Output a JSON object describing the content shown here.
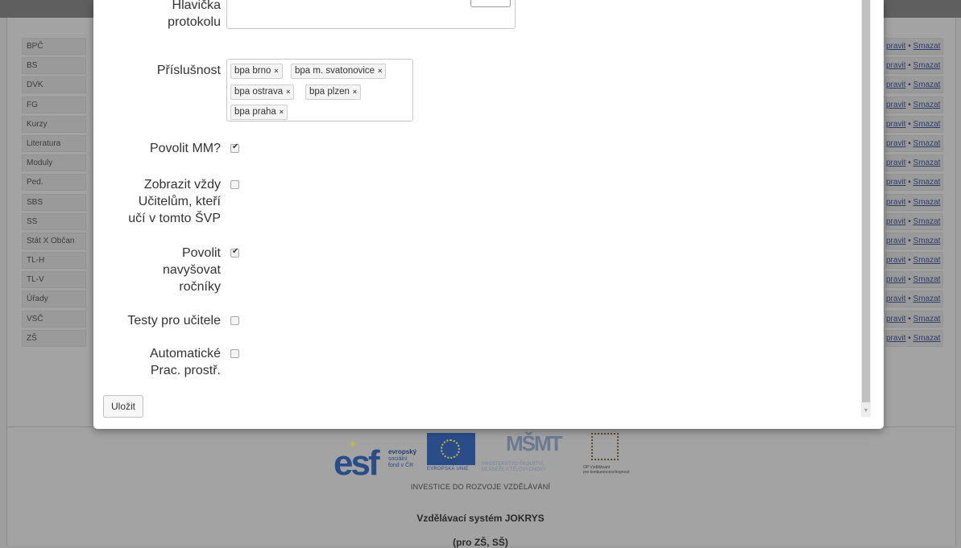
{
  "background": {
    "rows": [
      {
        "name": "BPČ"
      },
      {
        "name": "BS"
      },
      {
        "name": "DVK"
      },
      {
        "name": "FG"
      },
      {
        "name": "Kurzy"
      },
      {
        "name": "Literatura"
      },
      {
        "name": "Moduly"
      },
      {
        "name": "Ped."
      },
      {
        "name": "SBS"
      },
      {
        "name": "SS"
      },
      {
        "name": "Stát X Občan"
      },
      {
        "name": "TL-H"
      },
      {
        "name": "TL-V"
      },
      {
        "name": "Úřady"
      },
      {
        "name": "VSČ"
      },
      {
        "name": "ZŠ"
      }
    ],
    "edit_link": "pravit",
    "delete_link": "Smazat",
    "separator": "•",
    "footer": {
      "esf_letters": "esf",
      "esf_text_1": "evropský",
      "esf_text_2": "sociální",
      "esf_text_3": "fond v ČR",
      "eu_label": "EVROPSKÁ UNIE",
      "msmt_mark": "MŠMT",
      "msmt_text_1": "MINISTERSTVO ŠKOLSTVÍ,",
      "msmt_text_2": "MLÁDEŽE A TĚLOVÝCHOVY",
      "op_text_1": "OP Vzdělávání",
      "op_text_2": "pro konkurenceschopnost",
      "investice": "INVESTICE DO ROZVOJE VZDĚLÁVÁNÍ",
      "system_name": "Vzdělávací systém JOKRYS",
      "system_sub": "(pro ZŠ, SŠ)"
    }
  },
  "modal": {
    "header_label_1": "Hlavička",
    "header_label_2": "protokolu",
    "header_value": "",
    "membership_label": "Příslušnost",
    "tags": [
      {
        "label": "bpa brno"
      },
      {
        "label": "bpa m. svatonovice"
      },
      {
        "label": "bpa ostrava"
      },
      {
        "label": "bpa plzen"
      },
      {
        "label": "bpa praha"
      }
    ],
    "tag_remove": "×",
    "checkboxes": [
      {
        "label_lines": [
          "Povolit MM?"
        ],
        "checked": true
      },
      {
        "label_lines": [
          "Zobrazit vždy",
          "Učitelům, kteří",
          "učí v tomto ŠVP"
        ],
        "checked": false
      },
      {
        "label_lines": [
          "Povolit",
          "navyšovat",
          "ročníky"
        ],
        "checked": true
      },
      {
        "label_lines": [
          "Testy pro učitele"
        ],
        "checked": false
      },
      {
        "label_lines": [
          "Automatické",
          "Prac. prostř."
        ],
        "checked": false
      }
    ],
    "check_mark": "✔",
    "save_label": "Uložit"
  },
  "colors": {
    "overlay_gray": "#9e9e9e",
    "link_blue": "#2e3f6c",
    "modal_bg": "#ffffff"
  }
}
